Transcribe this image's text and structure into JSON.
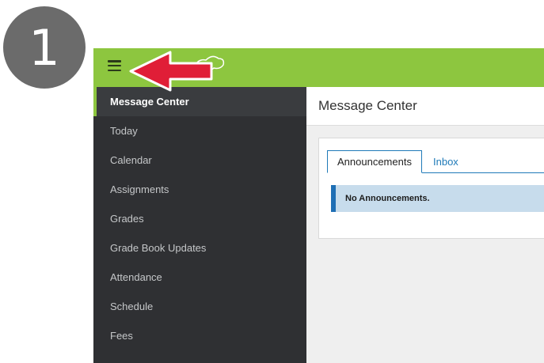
{
  "step_badge": {
    "number": "1"
  },
  "topbar": {
    "menu_icon": "hamburger-icon",
    "color": "#8dc63f"
  },
  "sidebar": {
    "items": [
      {
        "label": "Message Center",
        "active": true
      },
      {
        "label": "Today"
      },
      {
        "label": "Calendar"
      },
      {
        "label": "Assignments"
      },
      {
        "label": "Grades"
      },
      {
        "label": "Grade Book Updates"
      },
      {
        "label": "Attendance"
      },
      {
        "label": "Schedule"
      },
      {
        "label": "Fees"
      }
    ]
  },
  "main": {
    "title": "Message Center",
    "tabs": [
      {
        "label": "Announcements",
        "active": true
      },
      {
        "label": "Inbox"
      }
    ],
    "alert": "No Announcements."
  },
  "annotation": {
    "arrow_icon": "red-arrow-icon",
    "color": "#e01e37"
  },
  "colors": {
    "accent": "#8dc63f",
    "sidebar": "#2f3033",
    "link": "#1f7ab8",
    "alert_bg": "#c7dcec"
  }
}
